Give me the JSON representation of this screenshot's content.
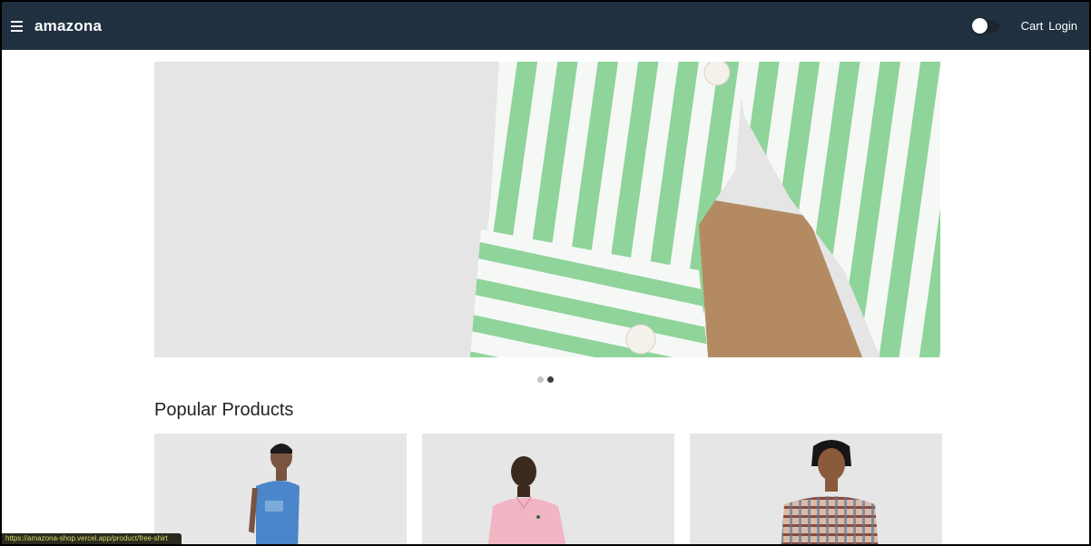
{
  "header": {
    "brand": "amazona",
    "cart_label": "Cart",
    "login_label": "Login"
  },
  "carousel": {
    "slide_count": 2,
    "active_slide": 2
  },
  "main": {
    "section_title": "Popular Products"
  },
  "status_url": "https://amazona-shop.vercel.app/product/free-shirt",
  "colors": {
    "header_bg": "#203040",
    "stripe_green": "#8fd49a",
    "background": "#ffffff"
  },
  "icons": {
    "menu": "hamburger-icon",
    "theme": "toggle-switch"
  }
}
